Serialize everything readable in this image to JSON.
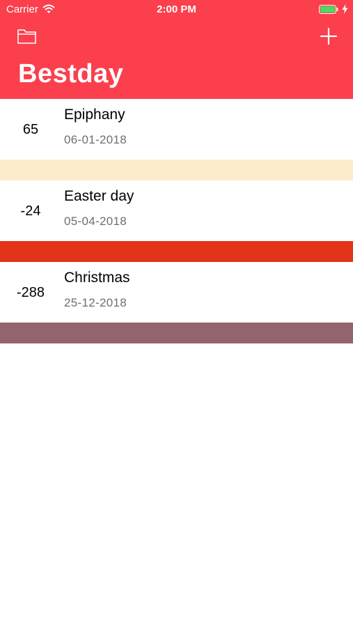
{
  "status_bar": {
    "carrier": "Carrier",
    "time": "2:00 PM",
    "battery_level": 1.0,
    "battery_color": "#4cd964"
  },
  "nav": {
    "title": "Bestday",
    "background_color": "#fb3f4d",
    "left_icon": "folder-icon",
    "right_icon": "plus-icon"
  },
  "events": [
    {
      "days": "65",
      "name": "Epiphany",
      "date": "06-01-2018",
      "color": "#fdeccc"
    },
    {
      "days": "-24",
      "name": "Easter day",
      "date": "05-04-2018",
      "color": "#e2331b"
    },
    {
      "days": "-288",
      "name": "Christmas",
      "date": "25-12-2018",
      "color": "#93646d"
    }
  ]
}
